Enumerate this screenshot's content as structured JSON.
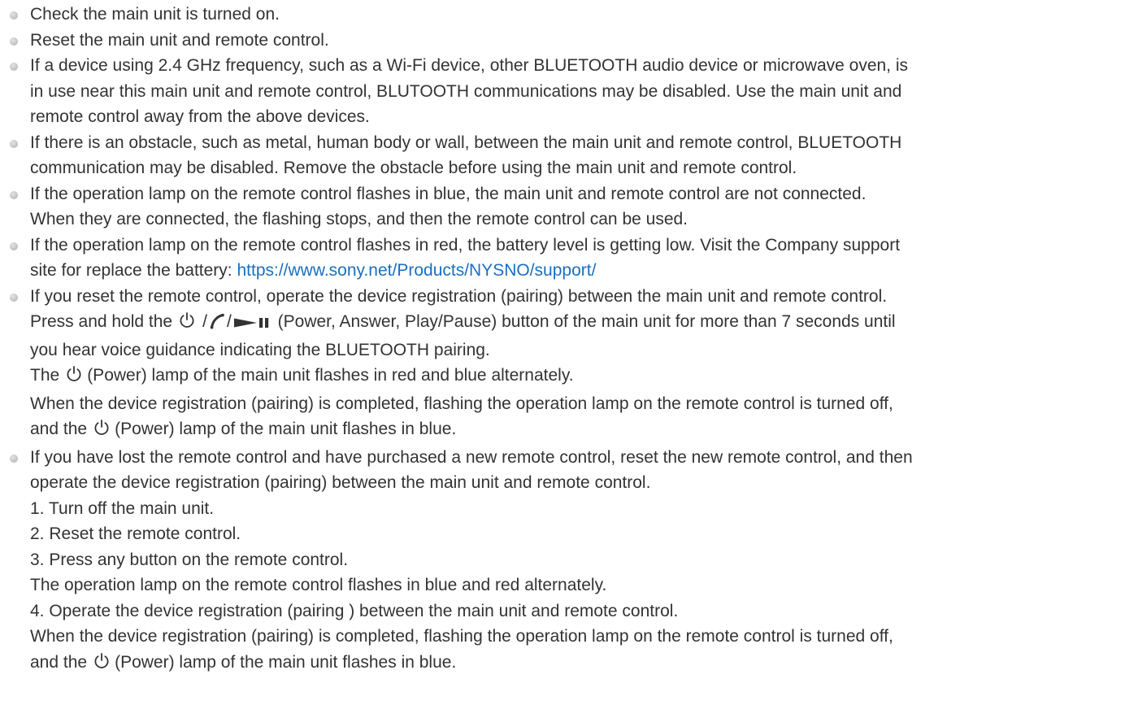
{
  "items": [
    {
      "text": "Check the main unit is turned on."
    },
    {
      "text": "Reset the main unit and remote control."
    },
    {
      "lines": [
        "If a device using 2.4 GHz frequency, such as a Wi-Fi device, other BLUETOOTH audio device or microwave oven, is",
        "in use near this main unit and remote control, BLUTOOTH communications may be disabled. Use the main unit and",
        "remote control away from the above devices."
      ]
    },
    {
      "lines": [
        "If there is an obstacle, such as metal, human body or wall, between the main unit and remote control, BLUETOOTH",
        "communication may be disabled. Remove the obstacle before using the main unit and remote control."
      ]
    },
    {
      "lines": [
        "If the operation lamp on the remote control flashes in blue, the main unit and remote control are not connected.",
        "When they are connected, the flashing stops, and then the remote control can be used."
      ]
    },
    {
      "line1": "If the operation lamp on the remote control flashes in red, the battery level is getting low. Visit the Company support",
      "line2_prefix": "site for replace the battery: ",
      "link": "https://www.sony.net/Products/NYSNO/support/"
    },
    {
      "line1": "If you reset the remote control, operate the device registration (pairing) between the main unit and remote control.",
      "press_prefix": "Press and hold the",
      "slash": "/",
      "press_suffix": "(Power, Answer, Play/Pause) button of the main unit for more than 7 seconds until",
      "line3": "you hear voice guidance indicating the BLUETOOTH pairing.",
      "the_prefix": "The",
      "power_lamp_text": "(Power) lamp of the main unit flashes in red and blue alternately.",
      "line5": "When the device registration (pairing) is completed, flashing the operation lamp on the remote control is turned off,",
      "and_the": "and the",
      "power_blue_text": "(Power) lamp of the main unit flashes in blue."
    },
    {
      "line1": "If you have lost the remote control and have purchased a new remote control, reset the new remote control, and then",
      "line2": "operate the device registration (pairing) between the main unit and remote control.",
      "step1": "1. Turn off the main unit.",
      "step2": "2. Reset the remote control.",
      "step3": "3. Press any button on the remote control.",
      "step3_note": "The operation lamp on the remote control flashes in blue and red alternately.",
      "step4": "4. Operate the device registration (pairing ) between the main unit and remote control.",
      "line8": "When the device registration (pairing) is completed, flashing the operation lamp on the remote control is turned off,",
      "and_the": "and the",
      "power_blue_text": "(Power) lamp of the main unit flashes in blue."
    }
  ],
  "colors": {
    "text": "#333333",
    "link": "#1a6fc0",
    "bullet": "#c6c6c6"
  },
  "icons": [
    "power-icon",
    "answer-icon",
    "play-pause-icon"
  ]
}
